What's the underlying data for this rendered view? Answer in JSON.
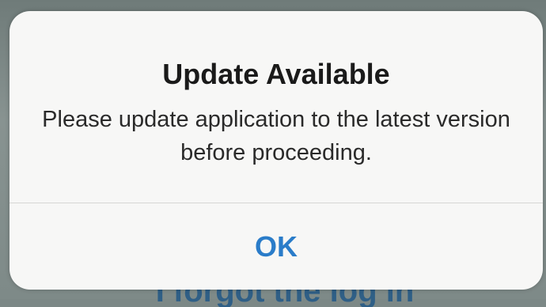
{
  "background": {
    "partial_link_text": "I forgot the log in"
  },
  "alert": {
    "title": "Update Available",
    "message": "Please update application to the latest version before proceeding.",
    "ok_label": "OK"
  },
  "colors": {
    "accent": "#2a7cc9",
    "alert_background": "#f7f7f6",
    "title_text": "#1a1a1a"
  }
}
